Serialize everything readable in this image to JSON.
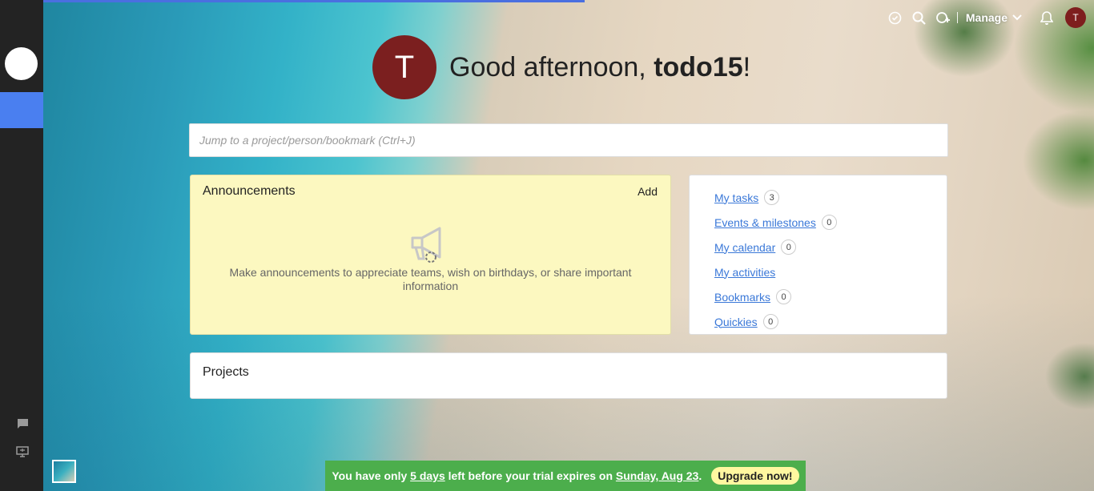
{
  "header": {
    "manage_label": "Manage",
    "user_initial": "T",
    "icons": [
      "timer-icon",
      "search-icon",
      "add-user-icon",
      "bell-icon"
    ]
  },
  "greeting": {
    "avatar_initial": "T",
    "prefix": "Good afternoon, ",
    "name": "todo15",
    "suffix": "!"
  },
  "search": {
    "placeholder": "Jump to a project/person/bookmark (Ctrl+J)"
  },
  "announcements": {
    "title": "Announcements",
    "add_label": "Add",
    "empty_text": "Make announcements to appreciate teams, wish on birthdays, or share important information"
  },
  "quick_links": [
    {
      "label": "My tasks",
      "count": "3"
    },
    {
      "label": "Events & milestones",
      "count": "0"
    },
    {
      "label": "My calendar",
      "count": "0"
    },
    {
      "label": "My activities",
      "count": null
    },
    {
      "label": "Bookmarks",
      "count": "0"
    },
    {
      "label": "Quickies",
      "count": "0"
    }
  ],
  "projects": {
    "title": "Projects"
  },
  "trial_banner": {
    "text_before": "You have only ",
    "days": "5 days",
    "text_middle": " left before your trial expires on ",
    "date": "Sunday, Aug 23",
    "text_after": ".",
    "upgrade_label": "Upgrade now!"
  },
  "colors": {
    "sidebar_bg": "#232323",
    "sidebar_active": "#4a7ff0",
    "avatar": "#7b1f1f",
    "announce_bg": "#fcf8c0",
    "link": "#3a78d8",
    "trial_bg": "#4cae4c",
    "upgrade_bg": "#fff7a0"
  }
}
